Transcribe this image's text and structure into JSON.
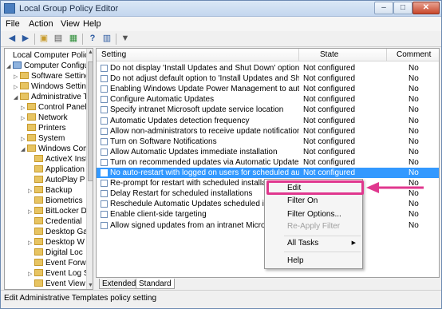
{
  "window": {
    "title": "Local Group Policy Editor",
    "controls": {
      "minimize": "–",
      "maximize": "□",
      "close": "✕"
    }
  },
  "menu": [
    "File",
    "Action",
    "View",
    "Help"
  ],
  "toolbar": {
    "icons": [
      "back-arrow-icon",
      "forward-arrow-icon",
      "up-folder-icon",
      "show-hide-tree-icon",
      "export-list-icon",
      "help-icon",
      "properties-icon",
      "filter-icon"
    ]
  },
  "tree": {
    "items": [
      {
        "label": "Local Computer Policy",
        "level": 0,
        "expander": "",
        "icon": "none"
      },
      {
        "label": "Computer Configurati",
        "level": 0,
        "expander": "◢",
        "icon": "computer-icon"
      },
      {
        "label": "Software Settings",
        "level": 1,
        "expander": "▷",
        "icon": "folder-icon"
      },
      {
        "label": "Windows Settings",
        "level": 1,
        "expander": "▷",
        "icon": "folder-icon"
      },
      {
        "label": "Administrative Te",
        "level": 1,
        "expander": "◢",
        "icon": "folder-icon"
      },
      {
        "label": "Control Panel",
        "level": 2,
        "expander": "▷",
        "icon": "folder-icon"
      },
      {
        "label": "Network",
        "level": 2,
        "expander": "▷",
        "icon": "folder-icon"
      },
      {
        "label": "Printers",
        "level": 2,
        "expander": "",
        "icon": "folder-icon"
      },
      {
        "label": "System",
        "level": 2,
        "expander": "▷",
        "icon": "folder-icon"
      },
      {
        "label": "Windows Comp",
        "level": 2,
        "expander": "◢",
        "icon": "folder-icon"
      },
      {
        "label": "ActiveX Inst",
        "level": 3,
        "expander": "",
        "icon": "folder-icon"
      },
      {
        "label": "Application",
        "level": 3,
        "expander": "",
        "icon": "folder-icon"
      },
      {
        "label": "AutoPlay P",
        "level": 3,
        "expander": "",
        "icon": "folder-icon"
      },
      {
        "label": "Backup",
        "level": 3,
        "expander": "▷",
        "icon": "folder-icon"
      },
      {
        "label": "Biometrics",
        "level": 3,
        "expander": "",
        "icon": "folder-icon"
      },
      {
        "label": "BitLocker D",
        "level": 3,
        "expander": "▷",
        "icon": "folder-icon"
      },
      {
        "label": "Credential",
        "level": 3,
        "expander": "",
        "icon": "folder-icon"
      },
      {
        "label": "Desktop Ga",
        "level": 3,
        "expander": "",
        "icon": "folder-icon"
      },
      {
        "label": "Desktop W",
        "level": 3,
        "expander": "▷",
        "icon": "folder-icon"
      },
      {
        "label": "Digital Loc",
        "level": 3,
        "expander": "",
        "icon": "folder-icon"
      },
      {
        "label": "Event Forw",
        "level": 3,
        "expander": "",
        "icon": "folder-icon"
      },
      {
        "label": "Event Log S",
        "level": 3,
        "expander": "▷",
        "icon": "folder-icon"
      },
      {
        "label": "Event View",
        "level": 3,
        "expander": "",
        "icon": "folder-icon"
      }
    ]
  },
  "table": {
    "columns": [
      "Setting",
      "State",
      "Comment"
    ],
    "rows": [
      {
        "setting": "Do not display 'Install Updates and Shut Down' option in Sh...",
        "state": "Not configured",
        "comment": "No",
        "selected": false
      },
      {
        "setting": "Do not adjust default option to 'Install Updates and Shut Do...",
        "state": "Not configured",
        "comment": "No",
        "selected": false
      },
      {
        "setting": "Enabling Windows Update Power Management to automati...",
        "state": "Not configured",
        "comment": "No",
        "selected": false
      },
      {
        "setting": "Configure Automatic Updates",
        "state": "Not configured",
        "comment": "No",
        "selected": false
      },
      {
        "setting": "Specify intranet Microsoft update service location",
        "state": "Not configured",
        "comment": "No",
        "selected": false
      },
      {
        "setting": "Automatic Updates detection frequency",
        "state": "Not configured",
        "comment": "No",
        "selected": false
      },
      {
        "setting": "Allow non-administrators to receive update notifications",
        "state": "Not configured",
        "comment": "No",
        "selected": false
      },
      {
        "setting": "Turn on Software Notifications",
        "state": "Not configured",
        "comment": "No",
        "selected": false
      },
      {
        "setting": "Allow Automatic Updates immediate installation",
        "state": "Not configured",
        "comment": "No",
        "selected": false
      },
      {
        "setting": "Turn on recommended updates via Automatic Updates",
        "state": "Not configured",
        "comment": "No",
        "selected": false
      },
      {
        "setting": "No auto-restart with logged on users for scheduled automat...",
        "state": "Not configured",
        "comment": "No",
        "selected": true
      },
      {
        "setting": "Re-prompt for restart with scheduled installations",
        "state": "",
        "comment": "No",
        "selected": false
      },
      {
        "setting": "Delay Restart for scheduled installations",
        "state": "",
        "comment": "No",
        "selected": false
      },
      {
        "setting": "Reschedule Automatic Updates scheduled installation",
        "state": "",
        "comment": "No",
        "selected": false
      },
      {
        "setting": "Enable client-side targeting",
        "state": "",
        "comment": "No",
        "selected": false
      },
      {
        "setting": "Allow signed updates from an intranet Microsoft up",
        "state": "",
        "comment": "No",
        "selected": false
      }
    ]
  },
  "tabs": [
    "Extended",
    "Standard"
  ],
  "status": "Edit Administrative Templates policy setting",
  "context_menu": {
    "items": [
      "Edit",
      "Filter On",
      "Filter Options...",
      "Re-Apply Filter",
      "All Tasks",
      "Help"
    ],
    "disabled": [
      "Re-Apply Filter"
    ],
    "submenu_arrow": "▶"
  },
  "annotation": {
    "highlight_color": "#e0378e"
  }
}
